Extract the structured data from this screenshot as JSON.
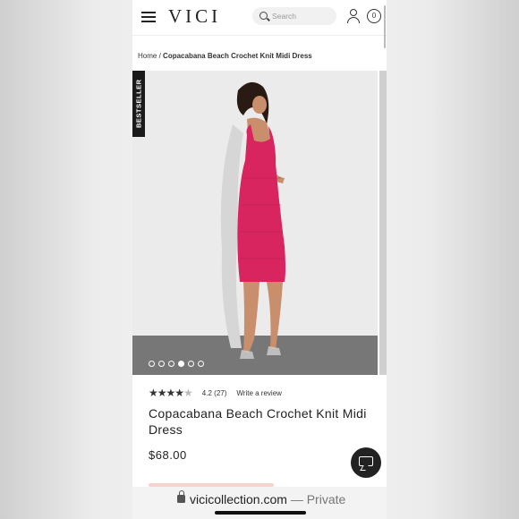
{
  "header": {
    "logo": "VICI",
    "search_placeholder": "Search",
    "cart_count": "0"
  },
  "breadcrumb": {
    "home": "Home",
    "separator": "/",
    "current": "Copacabana Beach Crochet Knit Midi Dress"
  },
  "gallery": {
    "badge": "BESTSELLER",
    "dots": 6,
    "active_dot_index": 3
  },
  "product": {
    "rating_stars": 4.2,
    "rating_text": "4.2",
    "review_count": "(27)",
    "write_review_label": "Write a review",
    "title": "Copacabana Beach Crochet Knit Midi Dress",
    "price": "$68.00"
  },
  "browser": {
    "url": "vicicollection.com",
    "private_label": "— Private"
  },
  "icons": {
    "menu": "hamburger-menu-icon",
    "search": "search-icon",
    "account": "account-icon",
    "cart": "cart-icon",
    "chat": "chat-icon",
    "lock": "lock-icon"
  },
  "colors": {
    "dress": "#d8245f",
    "badge_bg": "#1a1a1a",
    "chat_bg": "#222222"
  }
}
